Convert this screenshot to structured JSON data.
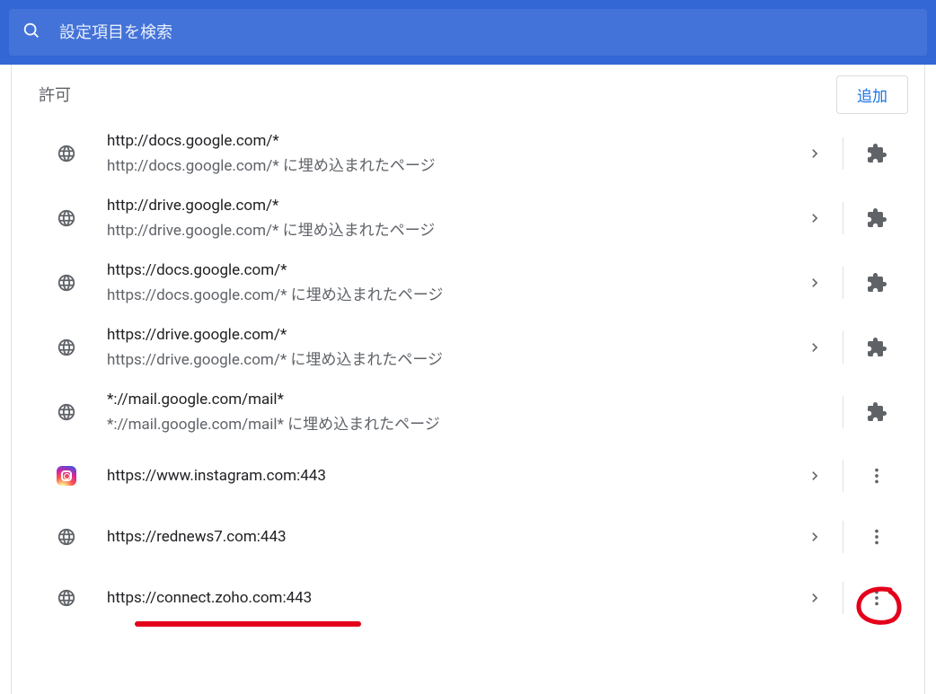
{
  "search": {
    "placeholder": "設定項目を検索"
  },
  "section": {
    "title": "許可",
    "add_label": "追加"
  },
  "sites": [
    {
      "url": "http://docs.google.com/*",
      "sub": "http://docs.google.com/* に埋め込まれたページ",
      "icon": "globe",
      "action": "puzzle",
      "has_arrow": true
    },
    {
      "url": "http://drive.google.com/*",
      "sub": "http://drive.google.com/* に埋め込まれたページ",
      "icon": "globe",
      "action": "puzzle",
      "has_arrow": true
    },
    {
      "url": "https://docs.google.com/*",
      "sub": "https://docs.google.com/* に埋め込まれたページ",
      "icon": "globe",
      "action": "puzzle",
      "has_arrow": true
    },
    {
      "url": "https://drive.google.com/*",
      "sub": "https://drive.google.com/* に埋め込まれたページ",
      "icon": "globe",
      "action": "puzzle",
      "has_arrow": true
    },
    {
      "url": "*://mail.google.com/mail*",
      "sub": "*://mail.google.com/mail* に埋め込まれたページ",
      "icon": "globe",
      "action": "puzzle",
      "has_arrow": false
    },
    {
      "url": "https://www.instagram.com:443",
      "sub": "",
      "icon": "instagram",
      "action": "more",
      "has_arrow": true
    },
    {
      "url": "https://rednews7.com:443",
      "sub": "",
      "icon": "globe",
      "action": "more",
      "has_arrow": true
    },
    {
      "url": "https://connect.zoho.com:443",
      "sub": "",
      "icon": "globe",
      "action": "more",
      "has_arrow": true
    }
  ]
}
